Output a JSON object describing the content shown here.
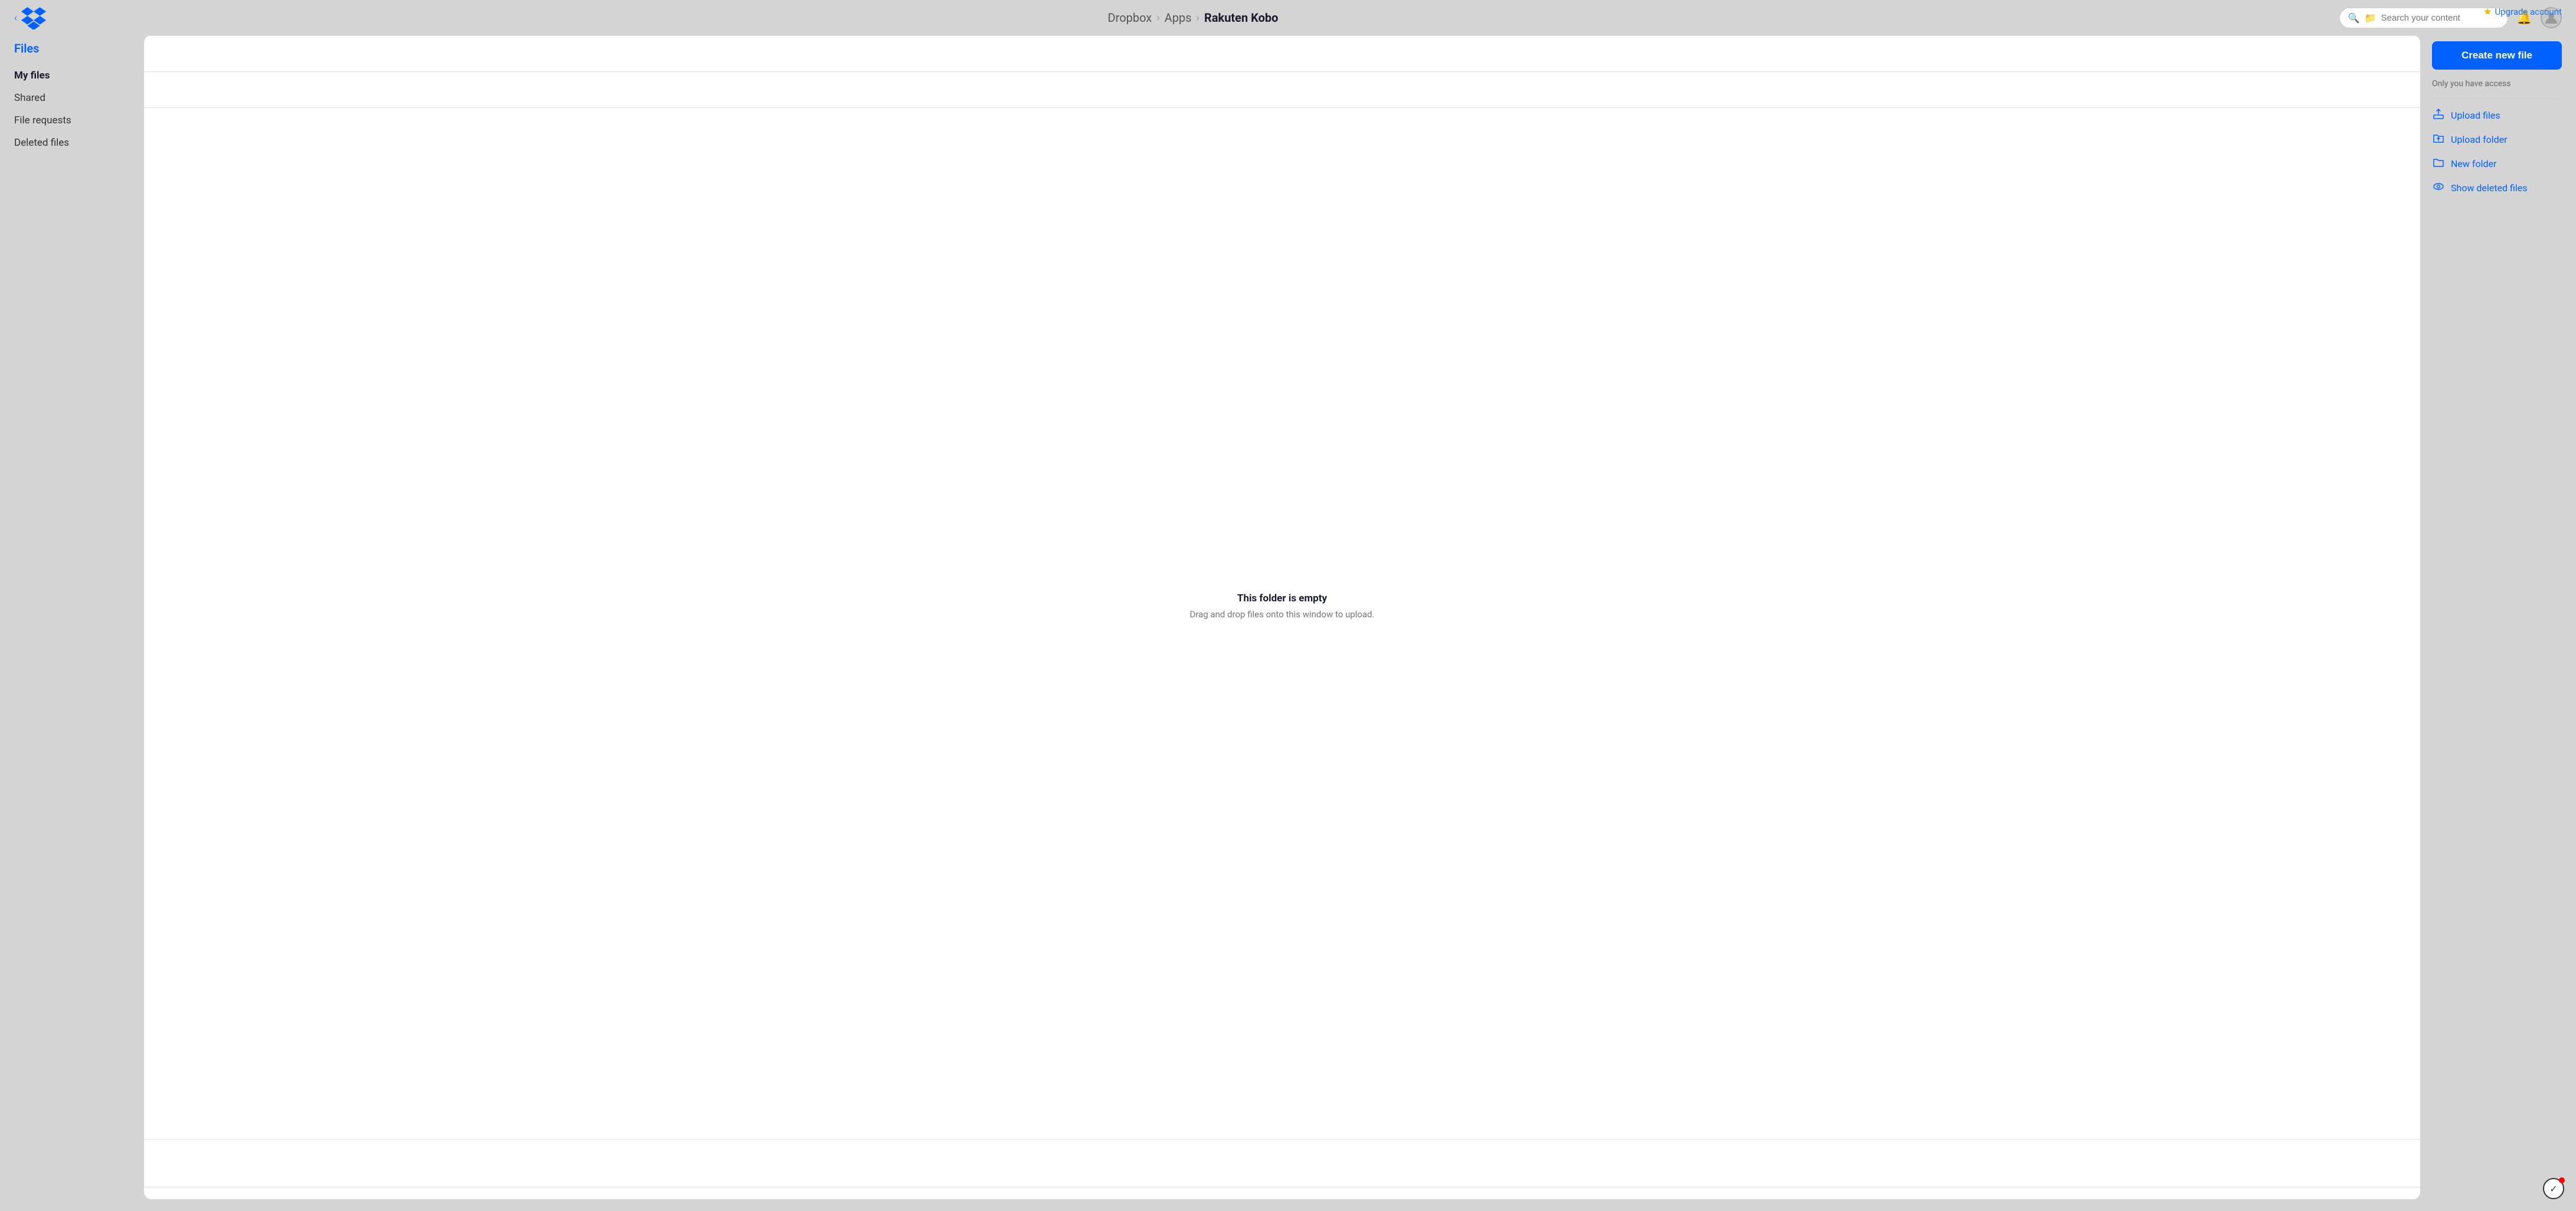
{
  "topbar": {
    "upgrade_label": "Upgrade account",
    "breadcrumb": {
      "part1": "Dropbox",
      "sep1": "›",
      "part2": "Apps",
      "sep2": "›",
      "current": "Rakuten Kobo"
    },
    "search": {
      "placeholder": "Search your content"
    }
  },
  "sidebar": {
    "files_heading": "Files",
    "nav_items": [
      {
        "label": "My files",
        "active": true
      },
      {
        "label": "Shared",
        "active": false
      },
      {
        "label": "File requests",
        "active": false
      },
      {
        "label": "Deleted files",
        "active": false
      }
    ]
  },
  "content": {
    "empty_title": "This folder is empty",
    "empty_subtitle": "Drag and drop files onto this window to upload."
  },
  "right_panel": {
    "create_btn_label": "Create new file",
    "access_text": "Only you have access",
    "actions": [
      {
        "label": "Upload files",
        "icon": "upload-files"
      },
      {
        "label": "Upload folder",
        "icon": "upload-folder"
      },
      {
        "label": "New folder",
        "icon": "new-folder"
      },
      {
        "label": "Show deleted files",
        "icon": "show-deleted"
      }
    ]
  }
}
